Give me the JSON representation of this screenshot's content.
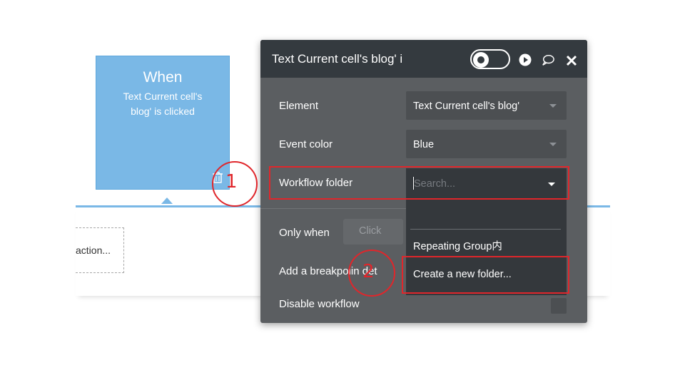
{
  "canvas": {
    "add_action_label": "action..."
  },
  "event_card": {
    "title": "When",
    "description": "Text Current cell's blog' is clicked"
  },
  "property_panel": {
    "title": "Text Current cell's blog' i",
    "header_icons": [
      "debug-toggle-icon",
      "play-icon",
      "comment-icon",
      "close-icon"
    ],
    "rows": {
      "element": {
        "label": "Element",
        "value": "Text Current cell's blog'"
      },
      "event_color": {
        "label": "Event color",
        "value": "Blue"
      },
      "workflow_folder": {
        "label": "Workflow folder",
        "placeholder": "Search..."
      },
      "only_when": {
        "label": "Only when",
        "value": "Click"
      },
      "breakpoint": {
        "label": "Add a breakpoint in debug mode",
        "visible_label": "Add a breakpoi",
        "visible_suffix": "in det"
      },
      "disable": {
        "label": "Disable workflow"
      }
    },
    "folder_options": [
      "Repeating Group内",
      "Create a new folder..."
    ]
  },
  "annotations": {
    "step1": "1",
    "step2": "2",
    "color": "#e0262b"
  },
  "colors": {
    "event_blue": "#7ab8e6",
    "panel_bg": "#5b5e61",
    "panel_header": "#343a3f"
  }
}
